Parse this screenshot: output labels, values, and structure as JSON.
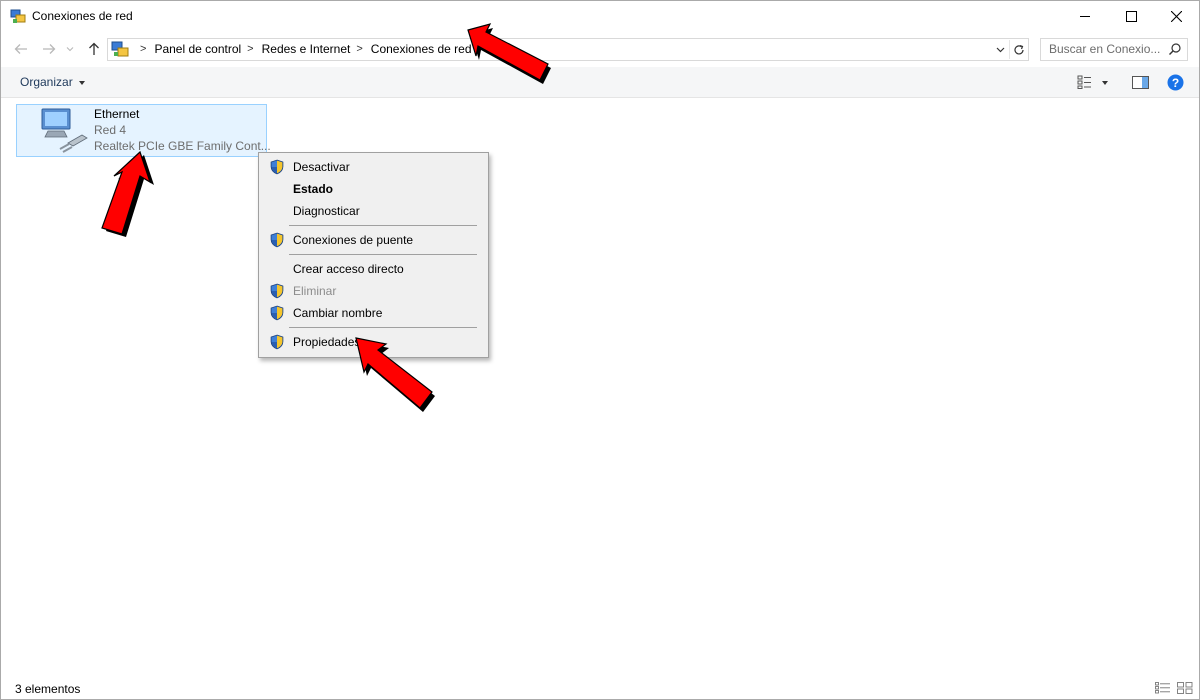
{
  "window": {
    "title": "Conexiones de red"
  },
  "address": {
    "crumbs": [
      "Panel de control",
      "Redes e Internet",
      "Conexiones de red"
    ]
  },
  "search": {
    "placeholder": "Buscar en Conexio..."
  },
  "commandbar": {
    "organize_label": "Organizar"
  },
  "connection": {
    "name": "Ethernet",
    "network": "Red 4",
    "device": "Realtek PCIe GBE Family Cont..."
  },
  "context_menu": {
    "items": [
      {
        "label": "Desactivar",
        "shield": true
      },
      {
        "label": "Estado",
        "bold": true
      },
      {
        "label": "Diagnosticar"
      },
      {
        "label": "Conexiones de puente",
        "shield": true
      },
      {
        "label": "Crear acceso directo"
      },
      {
        "label": "Eliminar",
        "shield": true,
        "disabled": true
      },
      {
        "label": "Cambiar nombre",
        "shield": true
      },
      {
        "label": "Propiedades",
        "shield": true
      }
    ]
  },
  "statusbar": {
    "count": "3 elementos"
  },
  "colors": {
    "selection_bg": "#e5f3ff",
    "selection_border": "#99d1ff",
    "annotation_arrow": "#ff0000",
    "help_blue": "#1a73e8"
  }
}
